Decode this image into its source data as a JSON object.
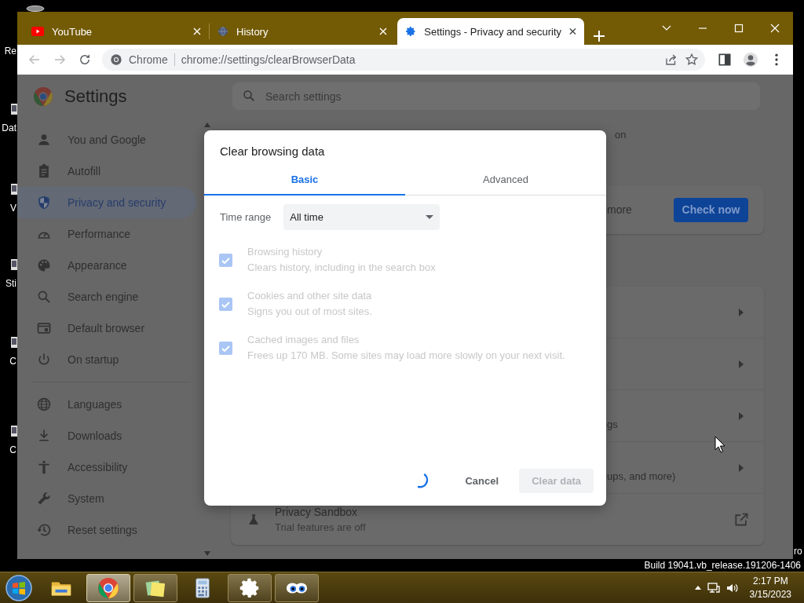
{
  "desktop": {
    "icon_labels": [
      {
        "text": "Re"
      },
      {
        "text": "Dat"
      },
      {
        "text": "V"
      },
      {
        "text": "Sti"
      },
      {
        "text": "C"
      },
      {
        "text": "C"
      }
    ],
    "edge_text": "ro",
    "build_text": "Build 19041.vb_release.191206-1406"
  },
  "browser": {
    "tabs": [
      {
        "kind": "youtube",
        "title": "YouTube",
        "selected": false
      },
      {
        "kind": "history",
        "title": "History",
        "selected": false
      },
      {
        "kind": "settings",
        "title": "Settings - Privacy and security",
        "selected": true
      }
    ],
    "site_label": "Chrome",
    "url": "chrome://settings/clearBrowserData"
  },
  "settings": {
    "title": "Settings",
    "search_placeholder": "Search settings",
    "sidebar_groups": [
      [
        {
          "label": "You and Google",
          "selected": false
        },
        {
          "label": "Autofill",
          "selected": false
        },
        {
          "label": "Privacy and security",
          "selected": true
        },
        {
          "label": "Performance",
          "selected": false
        },
        {
          "label": "Appearance",
          "selected": false
        },
        {
          "label": "Search engine",
          "selected": false
        },
        {
          "label": "Default browser",
          "selected": false
        },
        {
          "label": "On startup",
          "selected": false
        }
      ],
      [
        {
          "label": "Languages",
          "selected": false
        },
        {
          "label": "Downloads",
          "selected": false
        },
        {
          "label": "Accessibility",
          "selected": false
        },
        {
          "label": "System",
          "selected": false
        },
        {
          "label": "Reset settings",
          "selected": false
        }
      ]
    ],
    "heading_fragment": "on",
    "safety_card": {
      "text_fragment": "more",
      "button": "Check now"
    },
    "rows": [
      {
        "kind": "arrow"
      },
      {
        "kind": "arrow"
      },
      {
        "kind": "arrow",
        "text_fragment": "gs"
      },
      {
        "kind": "arrow",
        "text_fragment": "ups, and more)"
      },
      {
        "kind": "external",
        "title": "Privacy Sandbox",
        "subtitle": "Trial features are off"
      }
    ]
  },
  "dialog": {
    "title": "Clear browsing data",
    "tabs": [
      {
        "label": "Basic",
        "selected": true
      },
      {
        "label": "Advanced",
        "selected": false
      }
    ],
    "time_range": {
      "label": "Time range",
      "value": "All time"
    },
    "options": [
      {
        "title": "Browsing history",
        "subtitle": "Clears history, including in the search box",
        "checked": true,
        "disabled": true
      },
      {
        "title": "Cookies and other site data",
        "subtitle": "Signs you out of most sites.",
        "checked": true,
        "disabled": true
      },
      {
        "title": "Cached images and files",
        "subtitle": "Frees up 170 MB. Some sites may load more slowly on your next visit.",
        "checked": true,
        "disabled": true
      }
    ],
    "loading": true,
    "buttons": [
      {
        "kind": "cancel",
        "label": "Cancel",
        "disabled": false
      },
      {
        "kind": "confirm",
        "label": "Clear data",
        "disabled": true
      }
    ]
  },
  "taskbar": {
    "apps": [
      {
        "kind": "folder",
        "running": false,
        "selected": false
      },
      {
        "kind": "chrome",
        "running": true,
        "selected": true
      },
      {
        "kind": "notes",
        "running": true,
        "selected": false
      },
      {
        "kind": "calculator",
        "running": false,
        "selected": false
      },
      {
        "kind": "gear",
        "running": true,
        "selected": false
      },
      {
        "kind": "eyes",
        "running": true,
        "selected": false
      }
    ],
    "time": "2:17 PM",
    "date": "3/15/2023"
  }
}
